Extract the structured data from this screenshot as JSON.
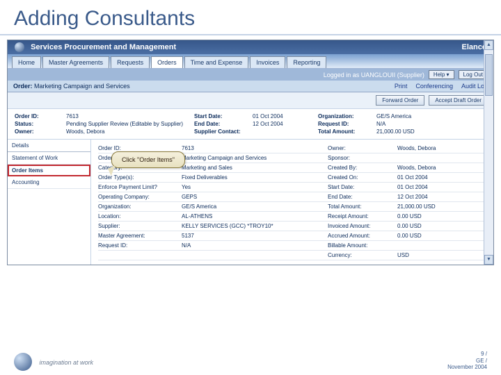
{
  "slide": {
    "title": "Adding Consultants"
  },
  "app": {
    "title": "Services Procurement and Management",
    "brand": "Elance"
  },
  "tabs": [
    "Home",
    "Master Agreements",
    "Requests",
    "Orders",
    "Time and Expense",
    "Invoices",
    "Reporting"
  ],
  "active_tab": "Orders",
  "user_bar": {
    "text": "Logged in as UANGLOUII (Supplier)",
    "help": "Help",
    "logout": "Log Out"
  },
  "order_bar": {
    "label": "Order:",
    "name": "Marketing Campaign and Services",
    "links": [
      "Print",
      "Conferencing",
      "Audit Log"
    ]
  },
  "actions": {
    "forward": "Forward Order",
    "accept": "Accept Draft Order"
  },
  "info": {
    "r1": {
      "a": "Order ID:",
      "av": "7613",
      "b": "Start Date:",
      "bv": "01 Oct 2004",
      "c": "Organization:",
      "cv": "GE/S America"
    },
    "r2": {
      "a": "Status:",
      "av": "Pending Supplier Review (Editable by Supplier)",
      "b": "End Date:",
      "bv": "12 Oct 2004",
      "c": "Request ID:",
      "cv": "N/A"
    },
    "r3": {
      "a": "Owner:",
      "av": "Woods, Debora",
      "b": "Supplier Contact:",
      "bv": "",
      "c": "Total Amount:",
      "cv": "21,000.00 USD"
    }
  },
  "side": {
    "items": [
      "Details",
      "Statement of Work",
      "Order Items",
      "Accounting"
    ]
  },
  "callout": "Click \"Order Items\"",
  "details": [
    {
      "l1": "Order ID:",
      "v1": "7613",
      "l2": "Owner:",
      "v2": "Woods, Debora"
    },
    {
      "l1": "Order Name:",
      "v1": "Marketing Campaign and Services",
      "l2": "Sponsor:",
      "v2": ""
    },
    {
      "l1": "Category:",
      "v1": "Marketing and Sales",
      "l2": "Created By:",
      "v2": "Woods, Debora"
    },
    {
      "l1": "Order Type(s):",
      "v1": "Fixed Deliverables",
      "l2": "Created On:",
      "v2": "01 Oct 2004"
    },
    {
      "l1": "Enforce Payment Limit?",
      "v1": "Yes",
      "l2": "Start Date:",
      "v2": "01 Oct 2004"
    },
    {
      "l1": "Operating Company:",
      "v1": "GEPS",
      "l2": "End Date:",
      "v2": "12 Oct 2004"
    },
    {
      "l1": "Organization:",
      "v1": "GE/S America",
      "l2": "Total Amount:",
      "v2": "21,000.00 USD"
    },
    {
      "l1": "Location:",
      "v1": "AL-ATHENS",
      "l2": "Receipt Amount:",
      "v2": "0.00 USD"
    },
    {
      "l1": "Supplier:",
      "v1": "KELLY SERVICES (GCC) *TROY10*",
      "l2": "Invoiced Amount:",
      "v2": "0.00 USD"
    },
    {
      "l1": "Master Agreement:",
      "v1": "5137",
      "l2": "Accrued Amount:",
      "v2": "0.00 USD"
    },
    {
      "l1": "Request ID:",
      "v1": "N/A",
      "l2": "Billable Amount:",
      "v2": ""
    },
    {
      "l1": "",
      "v1": "",
      "l2": "Currency:",
      "v2": "USD"
    }
  ],
  "footer": {
    "tagline": "imagination at work",
    "page": "9 /",
    "org": "GE /",
    "date": "November 2004"
  }
}
